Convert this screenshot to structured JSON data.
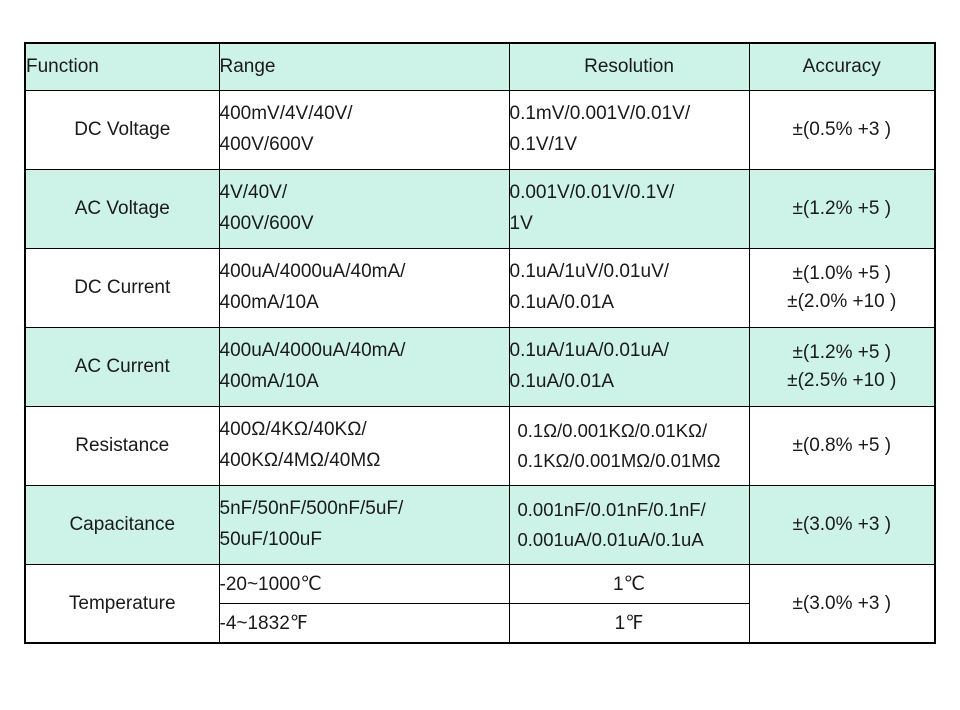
{
  "table": {
    "headers": {
      "function": "Function",
      "range": "Range",
      "resolution": "Resolution",
      "accuracy": "Accuracy"
    },
    "rows": [
      {
        "function": "DC Voltage",
        "range_lines": [
          "400mV/4V/40V/",
          "400V/600V"
        ],
        "resolution_lines": [
          "0.1mV/0.001V/0.01V/",
          "0.1V/1V"
        ],
        "accuracy_lines": [
          "±(0.5% +3 )"
        ]
      },
      {
        "function": "AC Voltage",
        "range_lines": [
          "4V/40V/",
          "400V/600V"
        ],
        "resolution_lines": [
          "0.001V/0.01V/0.1V/",
          "1V"
        ],
        "accuracy_lines": [
          "±(1.2% +5 )"
        ]
      },
      {
        "function": "DC Current",
        "range_lines": [
          "400uA/4000uA/40mA/",
          "400mA/10A"
        ],
        "resolution_lines": [
          "0.1uA/1uV/0.01uV/",
          "0.1uA/0.01A"
        ],
        "accuracy_lines": [
          "±(1.0% +5 )",
          "±(2.0% +10 )"
        ]
      },
      {
        "function": "AC Current",
        "range_lines": [
          "400uA/4000uA/40mA/",
          "400mA/10A"
        ],
        "resolution_lines": [
          "0.1uA/1uA/0.01uA/",
          "0.1uA/0.01A"
        ],
        "accuracy_lines": [
          "±(1.2% +5 )",
          "±(2.5% +10 )"
        ]
      },
      {
        "function": "Resistance",
        "range_lines": [
          "400Ω/4KΩ/40KΩ/",
          "400KΩ/4MΩ/40MΩ"
        ],
        "resolution_lines": [
          "0.1Ω/0.001KΩ/0.01KΩ/",
          "0.1KΩ/0.001MΩ/0.01MΩ"
        ],
        "accuracy_lines": [
          "±(0.8% +5 )"
        ]
      },
      {
        "function": "Capacitance",
        "range_lines": [
          "5nF/50nF/500nF/5uF/",
          "50uF/100uF"
        ],
        "resolution_lines": [
          "0.001nF/0.01nF/0.1nF/",
          "0.001uA/0.01uA/0.1uA"
        ],
        "accuracy_lines": [
          "±(3.0% +3 )"
        ]
      }
    ],
    "temperature": {
      "function": "Temperature",
      "accuracy": "±(3.0% +3 )",
      "subrows": [
        {
          "range": "-20~1000℃",
          "resolution": "1℃"
        },
        {
          "range": "-4~1832℉",
          "resolution": "1℉"
        }
      ]
    }
  },
  "colors": {
    "band": "#cdf2e8",
    "border": "#000000",
    "text": "#1a1a1a"
  }
}
